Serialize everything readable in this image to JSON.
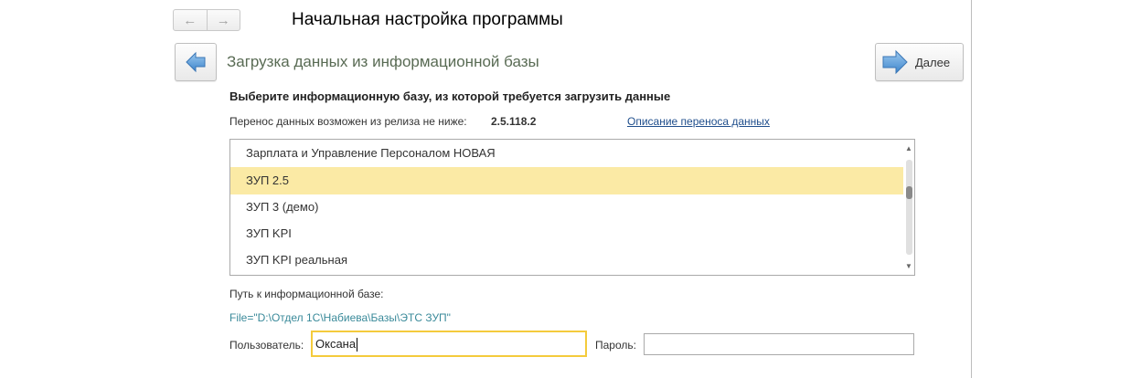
{
  "window": {
    "title": "Начальная настройка программы"
  },
  "nav": {
    "back_icon": "arrow-left-icon",
    "forward_icon": "arrow-right-icon"
  },
  "page": {
    "title": "Загрузка данных из информационной базы",
    "next_label": "Далее",
    "accent_arrow_color": "#5b9bd5"
  },
  "prompt": "Выберите информационную базу, из которой требуется загрузить данные",
  "release": {
    "label": "Перенос данных возможен из релиза не ниже:",
    "value": "2.5.118.2",
    "link": "Описание переноса данных"
  },
  "databases": {
    "items": [
      {
        "name": "Зарплата и Управление Персоналом НОВАЯ",
        "selected": false
      },
      {
        "name": "ЗУП 2.5",
        "selected": true
      },
      {
        "name": "ЗУП 3 (демо)",
        "selected": false
      },
      {
        "name": "ЗУП KPI",
        "selected": false
      },
      {
        "name": "ЗУП KPI реальная",
        "selected": false
      }
    ],
    "selected_color": "#fbeaa5"
  },
  "path": {
    "label": "Путь к информационной базе:",
    "value": "File=\"D:\\Отдел 1С\\Набиева\\Базы\\ЭТС ЗУП\""
  },
  "credentials": {
    "user_label": "Пользователь:",
    "user_value": "Оксана",
    "password_label": "Пароль:",
    "password_value": "",
    "focus_color": "#f4cb3c"
  }
}
